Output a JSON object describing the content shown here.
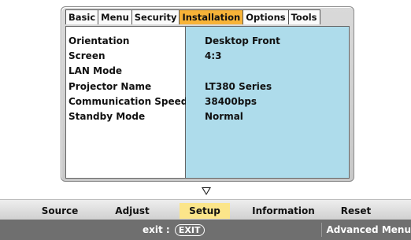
{
  "tabs": [
    {
      "label": "Basic",
      "active": false
    },
    {
      "label": "Menu",
      "active": false
    },
    {
      "label": "Security",
      "active": false
    },
    {
      "label": "Installation",
      "active": true
    },
    {
      "label": "Options",
      "active": false
    },
    {
      "label": "Tools",
      "active": false
    }
  ],
  "settings": [
    {
      "label": "Orientation",
      "value": "Desktop Front"
    },
    {
      "label": "Screen",
      "value": "4:3"
    },
    {
      "label": "LAN Mode",
      "value": ""
    },
    {
      "label": "Projector Name",
      "value": "LT380 Series"
    },
    {
      "label": "Communication Speed",
      "value": "38400bps"
    },
    {
      "label": "Standby Mode",
      "value": "Normal"
    }
  ],
  "menubar": [
    {
      "label": "Source",
      "active": false
    },
    {
      "label": "Adjust",
      "active": false
    },
    {
      "label": "Setup",
      "active": true
    },
    {
      "label": "Information",
      "active": false
    },
    {
      "label": "Reset",
      "active": false
    }
  ],
  "status": {
    "exit_prefix": "exit :",
    "exit_key": "EXIT",
    "advanced": "Advanced Menu"
  },
  "colors": {
    "active_tab": "#f7b338",
    "value_panel": "#aedceb",
    "active_menu": "#fbe58a",
    "status_bar": "#6f6f6f"
  }
}
